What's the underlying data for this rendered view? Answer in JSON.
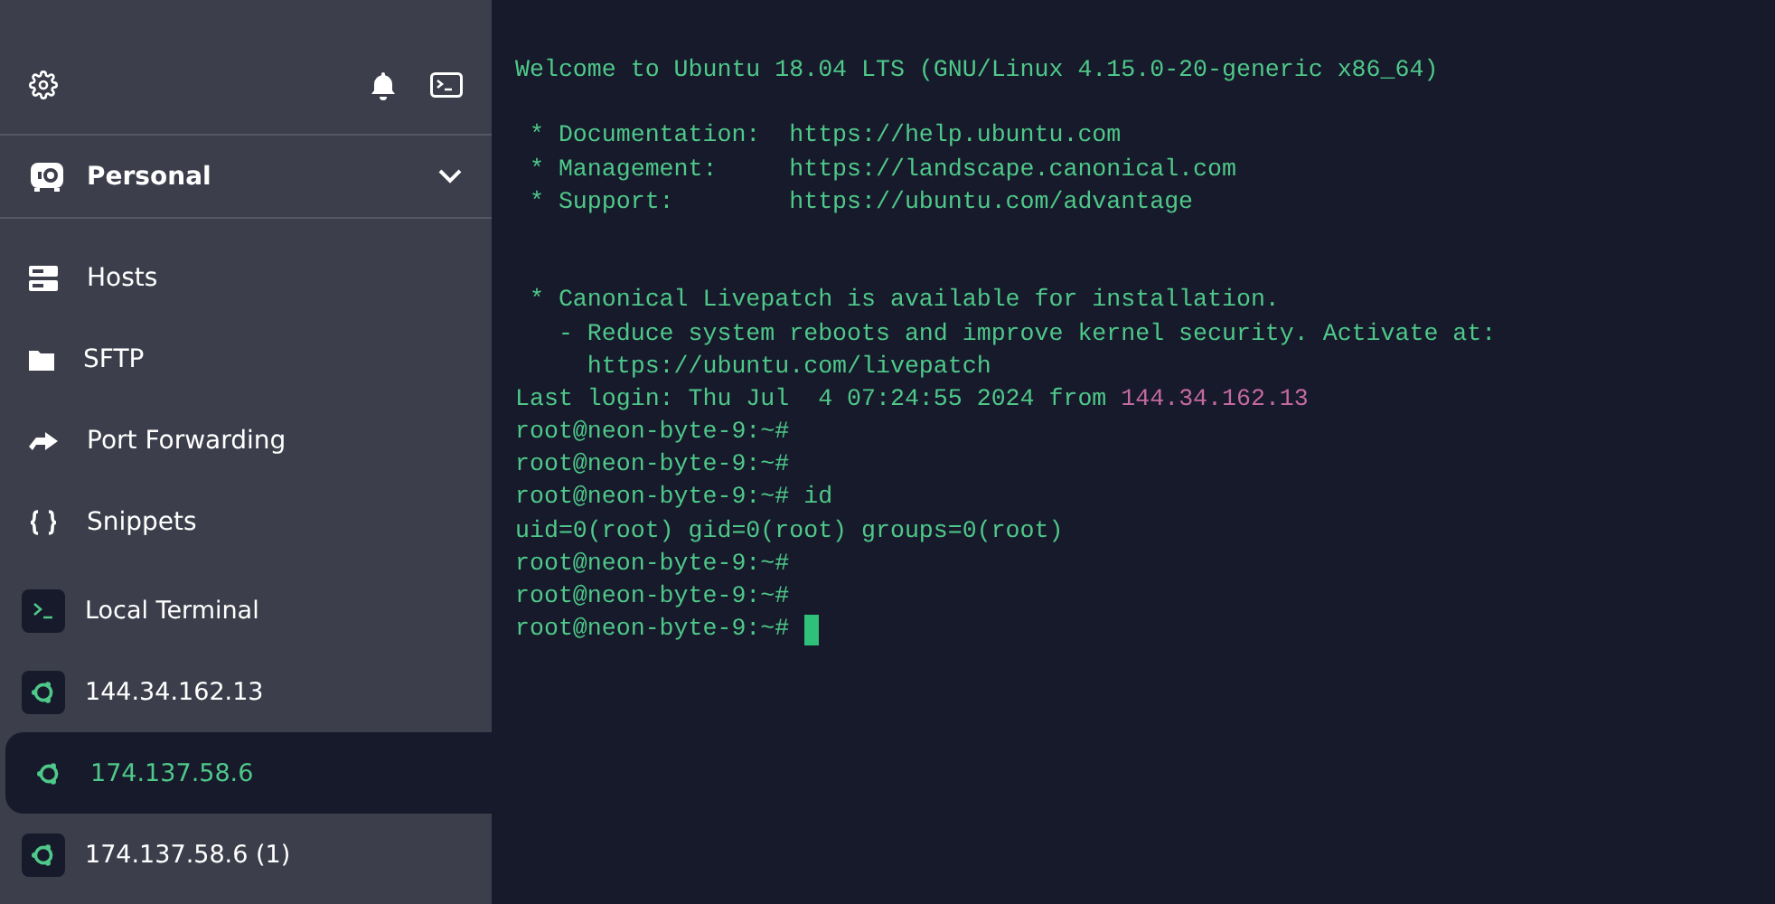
{
  "sidebar": {
    "workspace": {
      "label": "Personal",
      "expanded": false
    },
    "nav_items": [
      {
        "label": "Hosts"
      },
      {
        "label": "SFTP"
      },
      {
        "label": "Port Forwarding"
      },
      {
        "label": "Snippets"
      }
    ],
    "hosts": [
      {
        "label": "Local Terminal",
        "kind": "local",
        "selected": false
      },
      {
        "label": "144.34.162.13",
        "kind": "ubuntu",
        "selected": false
      },
      {
        "label": "174.137.58.6",
        "kind": "ubuntu",
        "selected": true
      },
      {
        "label": "174.137.58.6 (1)",
        "kind": "ubuntu",
        "selected": false
      }
    ]
  },
  "terminal": {
    "lines": [
      {
        "kind": "text",
        "text": "Welcome to Ubuntu 18.04 LTS (GNU/Linux 4.15.0-20-generic x86_64)"
      },
      {
        "kind": "blank"
      },
      {
        "kind": "text",
        "text": " * Documentation:  https://help.ubuntu.com"
      },
      {
        "kind": "text",
        "text": " * Management:     https://landscape.canonical.com"
      },
      {
        "kind": "text",
        "text": " * Support:        https://ubuntu.com/advantage"
      },
      {
        "kind": "blank"
      },
      {
        "kind": "blank"
      },
      {
        "kind": "text",
        "text": " * Canonical Livepatch is available for installation."
      },
      {
        "kind": "text",
        "text": "   - Reduce system reboots and improve kernel security. Activate at:"
      },
      {
        "kind": "text",
        "text": "     https://ubuntu.com/livepatch"
      },
      {
        "kind": "login",
        "text": "Last login: Thu Jul  4 07:24:55 2024 from",
        "address": "144.34.162.13"
      },
      {
        "kind": "text",
        "text": "root@neon-byte-9:~#"
      },
      {
        "kind": "text",
        "text": "root@neon-byte-9:~#"
      },
      {
        "kind": "text",
        "text": "root@neon-byte-9:~# id"
      },
      {
        "kind": "text",
        "text": "uid=0(root) gid=0(root) groups=0(root)"
      },
      {
        "kind": "text",
        "text": "root@neon-byte-9:~#"
      },
      {
        "kind": "text",
        "text": "root@neon-byte-9:~#"
      },
      {
        "kind": "prompt",
        "text": "root@neon-byte-9:~#",
        "cursor": true
      }
    ]
  }
}
